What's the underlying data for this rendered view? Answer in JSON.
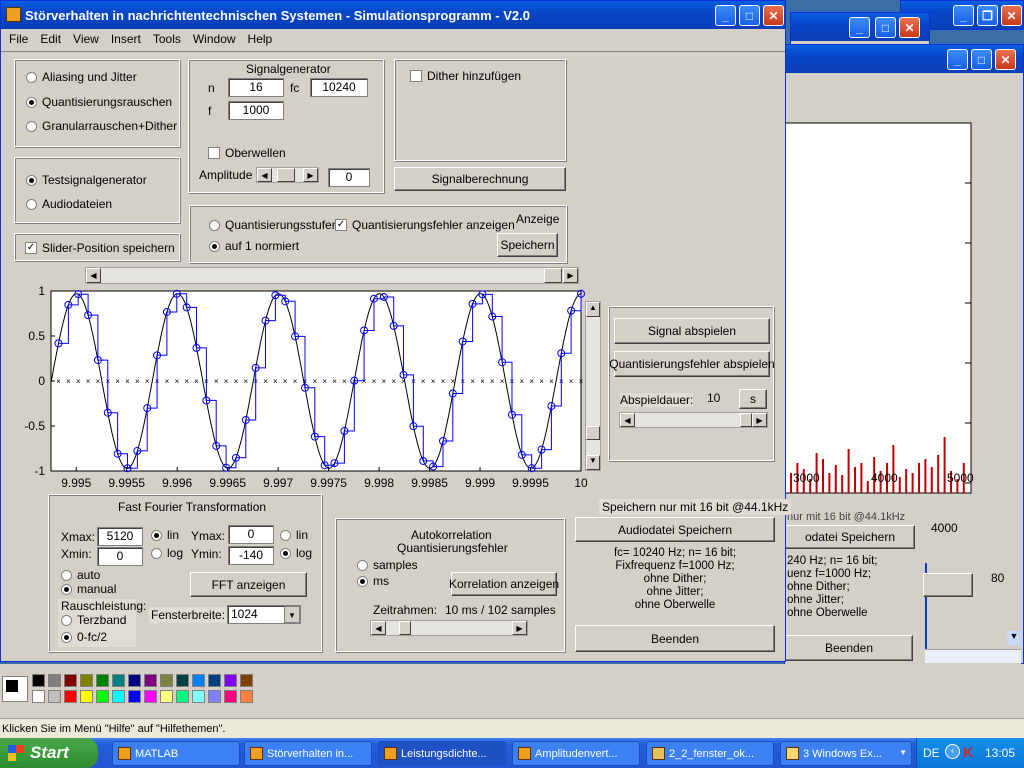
{
  "main_window": {
    "title": "Störverhalten in nachrichtentechnischen Systemen - Simulationsprogramm - V2.0",
    "menu": [
      "File",
      "Edit",
      "View",
      "Insert",
      "Tools",
      "Window",
      "Help"
    ]
  },
  "mode": {
    "options": [
      "Aliasing und Jitter",
      "Quantisierungsrauschen",
      "Granularrauschen+Dither"
    ],
    "selected": 1
  },
  "source": {
    "options": [
      "Testsignalgenerator",
      "Audiodateien"
    ],
    "selected": 0
  },
  "slider_save": {
    "label": "Slider-Position speichern",
    "checked": true
  },
  "siggen": {
    "title": "Signalgenerator",
    "n_label": "n",
    "n_value": "16",
    "fc_label": "fc",
    "fc_value": "10240",
    "f_label": "f",
    "f_value": "1000",
    "harmonics_label": "Oberwellen",
    "amplitude_label": "Amplitude",
    "amplitude_value": "0"
  },
  "dither": {
    "label": "Dither hinzufügen"
  },
  "signal_calc_label": "Signalberechnung",
  "display": {
    "title": "Anzeige",
    "opt1": "Quantisierungsstufen",
    "opt2": "auf 1 normiert",
    "error_check": "Quantisierungsfehler anzeigen",
    "save_label": "Speichern"
  },
  "chart_data": {
    "type": "line",
    "xlim": [
      9.99475,
      10.0
    ],
    "ylim": [
      -1,
      1
    ],
    "xticks": [
      "9.995",
      "9.9955",
      "9.996",
      "9.9965",
      "9.997",
      "9.9975",
      "9.998",
      "9.9985",
      "9.999",
      "9.9995",
      "10"
    ],
    "yticks": [
      "1",
      "0.5",
      "0",
      "-0.5",
      "-1"
    ],
    "series": [
      {
        "values": "sine f=1000 Hz sampled at fc=10240 Hz, quantized 16 bit"
      }
    ]
  },
  "playback": {
    "play_signal": "Signal abspielen",
    "play_error": "Quantisierungsfehler abspielen",
    "duration_label": "Abspieldauer:",
    "duration_value": "10",
    "unit": "s"
  },
  "fft": {
    "title": "Fast Fourier Transformation",
    "xmax_label": "Xmax:",
    "xmax_value": "5120",
    "xmin_label": "Xmin:",
    "xmin_value": "0",
    "ymax_label": "Ymax:",
    "ymax_value": "0",
    "ymin_label": "Ymin:",
    "ymin_value": "-140",
    "lin": "lin",
    "log": "log",
    "auto": "auto",
    "manual": "manual",
    "noise_label": "Rauschleistung:",
    "terzband": "Terzband",
    "fc2": "0-fc/2",
    "window_label": "Fensterbreite:",
    "window_value": "1024",
    "show_button": "FFT anzeigen"
  },
  "autocorr": {
    "title1": "Autokorrelation",
    "title2": "Quantisierungsfehler",
    "samples": "samples",
    "ms": "ms",
    "show_button": "Korrelation anzeigen",
    "timeframe_label": "Zeitrahmen:",
    "timeframe_value": "10 ms / 102 samples"
  },
  "save_audio": {
    "note": "Speichern nur mit 16 bit @44.1kHz",
    "button": "Audiodatei Speichern"
  },
  "info": [
    "fc= 10240 Hz; n= 16 bit;",
    "Fixfrequenz f=1000 Hz;",
    "ohne Dither;",
    "ohne Jitter;",
    "ohne Oberwelle"
  ],
  "end_label": "Beenden",
  "bg_window": {
    "xticks": [
      "3000",
      "4000",
      "5000"
    ],
    "partial_value": "4000",
    "note": "nur mit 16 bit @44.1kHz",
    "save": "odatei Speichern",
    "info": [
      "240 Hz; n= 16 bit;",
      "uenz f=1000 Hz;",
      "ohne Dither;",
      "ohne Jitter;",
      "ohne Oberwelle"
    ],
    "end": "Beenden",
    "partial_80": "80"
  },
  "statusbar": "Klicken Sie im Menü \"Hilfe\" auf \"Hilfethemen\".",
  "taskbar": {
    "start": "Start",
    "items": [
      "MATLAB",
      "Störverhalten in...",
      "Leistungsdichte...",
      "Amplitudenvert...",
      "2_2_fenster_ok...",
      "3 Windows Ex..."
    ],
    "lang": "DE",
    "clock": "13:05"
  },
  "colors": {
    "titlebar": "#0a3fb5",
    "face": "#d4d0c8",
    "plot_blue": "#0000ff",
    "spectrum_red": "#c00000"
  }
}
